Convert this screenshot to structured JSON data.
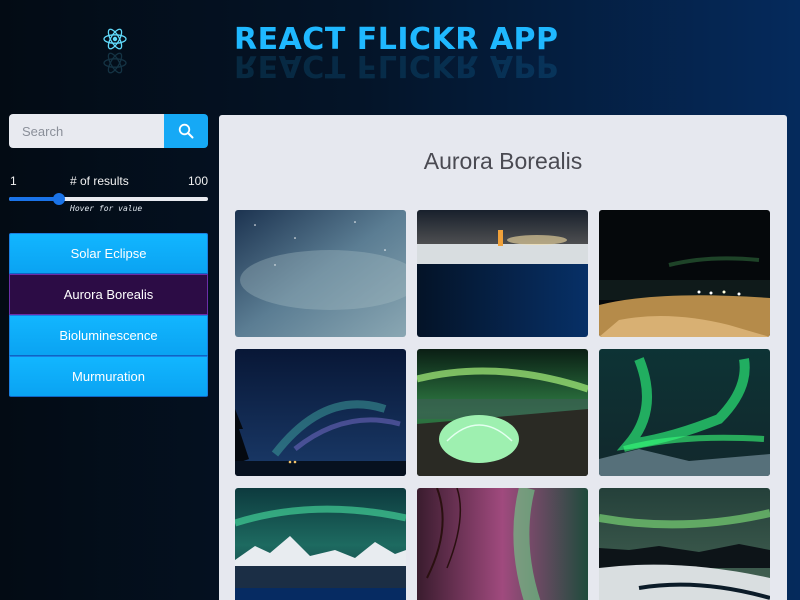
{
  "app": {
    "title": "REACT FLICKR APP",
    "logo_icon": "react-atom-icon"
  },
  "search": {
    "placeholder": "Search",
    "value": "",
    "button_icon": "search-icon"
  },
  "results_slider": {
    "min_label": "1",
    "label": "# of results",
    "max_label": "100",
    "value_fraction": 0.25,
    "hint": "Hover for value"
  },
  "topics": [
    {
      "label": "Solar Eclipse",
      "active": false
    },
    {
      "label": "Aurora Borealis",
      "active": true
    },
    {
      "label": "Bioluminescence",
      "active": false
    },
    {
      "label": "Murmuration",
      "active": false
    }
  ],
  "gallery": {
    "title": "Aurora Borealis",
    "photos": [
      "aurora-starry-sky",
      "lighthouse-snow-night",
      "beach-night-lights",
      "aurora-forest-lake",
      "aurora-tent",
      "aurora-green-swirl",
      "aurora-mountains",
      "aurora-pink-green-sky",
      "aurora-snowy-valley"
    ]
  },
  "colors": {
    "accent": "#16a9f5",
    "active_topic": "#2c0c45",
    "title": "#1fb8ff"
  }
}
